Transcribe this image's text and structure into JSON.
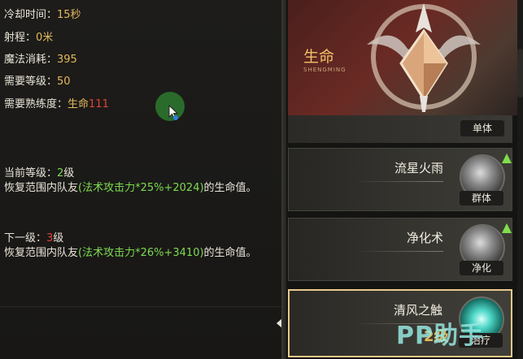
{
  "stats": {
    "cooldown_label": "冷却时间：",
    "cooldown_value": "15秒",
    "range_label": "射程：",
    "range_value": "0米",
    "mana_label": "魔法消耗：",
    "mana_value": "395",
    "level_req_label": "需要等级：",
    "level_req_value": "50",
    "proficiency_label": "需要熟练度：",
    "proficiency_skill": "生命",
    "proficiency_value": "111"
  },
  "current": {
    "label": "当前等级：",
    "level": "2",
    "level_unit": "级",
    "desc_prefix": "恢复范围内队友",
    "formula": "(法术攻击力*25%+2024)",
    "desc_suffix": "的生命值。"
  },
  "next": {
    "label": "下一级：",
    "level": "3",
    "level_unit": "级",
    "desc_prefix": "恢复范围内队友",
    "formula": "(法术攻击力*26%+3410)",
    "desc_suffix": "的生命值。"
  },
  "banner": {
    "title": "生命",
    "subtitle": "SHENGMING"
  },
  "skills": [
    {
      "name": "",
      "tag": "单体"
    },
    {
      "name": "流星火雨",
      "tag": "群体"
    },
    {
      "name": "净化术",
      "tag": "净化"
    },
    {
      "name": "清风之触",
      "tag": "治疗",
      "level": "2级"
    }
  ],
  "watermark": "PP助手",
  "colors": {
    "gold": "#e3b95b",
    "red": "#e04238",
    "green": "#7ddb52",
    "teal": "#4fd8c8"
  }
}
